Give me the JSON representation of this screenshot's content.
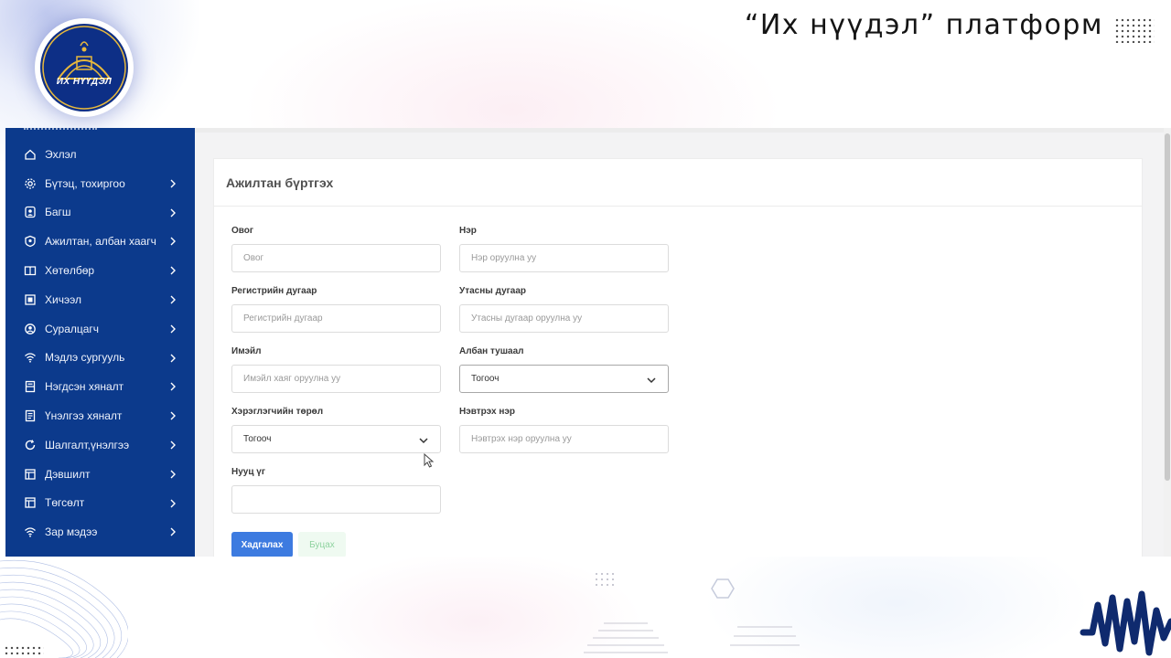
{
  "slide": {
    "title": "“Их нүүдэл” платформ",
    "logo_text": "ИХ НҮҮДЭЛ"
  },
  "colors": {
    "sidebar_bg": "#0c3a8c",
    "primary_button": "#3d7be0",
    "back_button_bg": "#effaf1",
    "back_button_text": "#8fd3a0"
  },
  "sidebar": {
    "items": [
      {
        "label": "Эхлэл",
        "icon": "home-icon",
        "has_chevron": false
      },
      {
        "label": "Бүтэц, тохиргоо",
        "icon": "gear-icon",
        "has_chevron": true
      },
      {
        "label": "Багш",
        "icon": "user-badge-icon",
        "has_chevron": true
      },
      {
        "label": "Ажилтан, албан хаагч",
        "icon": "staff-badge-icon",
        "has_chevron": true
      },
      {
        "label": "Хөтөлбөр",
        "icon": "book-icon",
        "has_chevron": true
      },
      {
        "label": "Хичээл",
        "icon": "lesson-icon",
        "has_chevron": true
      },
      {
        "label": "Суралцагч",
        "icon": "student-icon",
        "has_chevron": true
      },
      {
        "label": "Мэдлэ сургууль",
        "icon": "wifi-icon",
        "has_chevron": true
      },
      {
        "label": "Нэгдсэн хяналт",
        "icon": "report-icon",
        "has_chevron": true
      },
      {
        "label": "Үнэлгээ хяналт",
        "icon": "document-icon",
        "has_chevron": true
      },
      {
        "label": "Шалгалт,үнэлгээ",
        "icon": "refresh-icon",
        "has_chevron": true
      },
      {
        "label": "Дэвшилт",
        "icon": "layout-icon",
        "has_chevron": true
      },
      {
        "label": "Төгсөлт",
        "icon": "layout-icon",
        "has_chevron": true
      },
      {
        "label": "Зар мэдээ",
        "icon": "wifi-icon",
        "has_chevron": true
      }
    ]
  },
  "form": {
    "title": "Ажилтан бүртгэх",
    "last_name": {
      "label": "Овог",
      "placeholder": "Овог",
      "value": ""
    },
    "first_name": {
      "label": "Нэр",
      "placeholder": "Нэр оруулна уу",
      "value": ""
    },
    "register_no": {
      "label": "Регистрийн дугаар",
      "placeholder": "Регистрийн дугаар",
      "value": ""
    },
    "phone": {
      "label": "Утасны дугаар",
      "placeholder": "Утасны дугаар оруулна уу",
      "value": ""
    },
    "email": {
      "label": "Имэйл",
      "placeholder": "Имэйл хаяг оруулна уу",
      "value": ""
    },
    "position": {
      "label": "Албан тушаал",
      "selected": "Тогооч"
    },
    "user_type": {
      "label": "Хэрэглэгчийн төрөл",
      "selected": "Тогооч"
    },
    "username": {
      "label": "Нэвтрэх нэр",
      "placeholder": "Нэвтрэх нэр оруулна уу",
      "value": ""
    },
    "password": {
      "label": "Нууц үг",
      "placeholder": "",
      "value": ""
    },
    "save_label": "Хадгалах",
    "back_label": "Буцах"
  }
}
